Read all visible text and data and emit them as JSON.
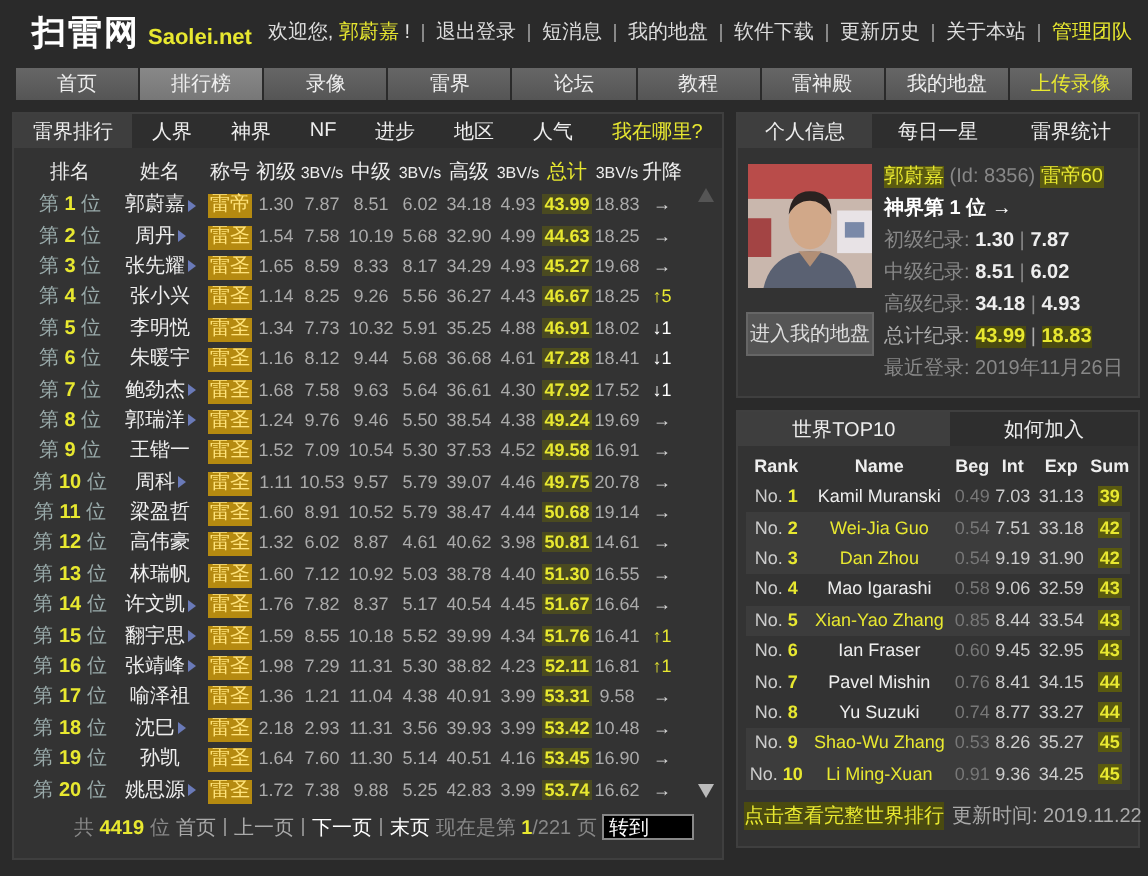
{
  "header": {
    "logo": "扫雷网",
    "logo_sub": "Saolei.net",
    "welcome": "欢迎您,",
    "user": "郭蔚嘉",
    "user_suffix": "!",
    "links": [
      {
        "label": "退出登录",
        "highlighted": false
      },
      {
        "label": "短消息",
        "highlighted": false
      },
      {
        "label": "我的地盘",
        "highlighted": false
      },
      {
        "label": "软件下载",
        "highlighted": false
      },
      {
        "label": "更新历史",
        "highlighted": false
      },
      {
        "label": "关于本站",
        "highlighted": false
      },
      {
        "label": "管理团队",
        "highlighted": true
      }
    ]
  },
  "nav": [
    {
      "label": "首页",
      "selected": false,
      "highlighted": false
    },
    {
      "label": "排行榜",
      "selected": true,
      "highlighted": false
    },
    {
      "label": "录像",
      "selected": false,
      "highlighted": false
    },
    {
      "label": "雷界",
      "selected": false,
      "highlighted": false
    },
    {
      "label": "论坛",
      "selected": false,
      "highlighted": false
    },
    {
      "label": "教程",
      "selected": false,
      "highlighted": false
    },
    {
      "label": "雷神殿",
      "selected": false,
      "highlighted": false
    },
    {
      "label": "我的地盘",
      "selected": false,
      "highlighted": false
    },
    {
      "label": "上传录像",
      "selected": false,
      "highlighted": true
    }
  ],
  "ranking": {
    "tabs": [
      {
        "label": "雷界排行",
        "selected": true,
        "highlighted": false
      },
      {
        "label": "人界",
        "selected": false,
        "highlighted": false
      },
      {
        "label": "神界",
        "selected": false,
        "highlighted": false
      },
      {
        "label": "NF",
        "selected": false,
        "highlighted": false
      },
      {
        "label": "进步",
        "selected": false,
        "highlighted": false
      },
      {
        "label": "地区",
        "selected": false,
        "highlighted": false
      },
      {
        "label": "人气",
        "selected": false,
        "highlighted": false
      },
      {
        "label": "我在哪里?",
        "selected": false,
        "highlighted": true
      }
    ],
    "columns": [
      "排名",
      "姓名",
      "称号",
      "初级",
      "3BV/s",
      "中级",
      "3BV/s",
      "高级",
      "3BV/s",
      "总计",
      "3BV/s",
      "升降"
    ],
    "rows": [
      {
        "rank": "第 **1** 位",
        "name": "郭蔚嘉",
        "video": true,
        "title": "雷帝",
        "values": [
          "1.30",
          "7.87",
          "8.51",
          "6.02",
          "34.18",
          "4.93",
          "43.99",
          "18.83"
        ],
        "change": "→",
        "kind": "same"
      },
      {
        "rank": "第 **2** 位",
        "name": "周丹",
        "video": true,
        "title": "雷圣",
        "values": [
          "1.54",
          "7.58",
          "10.19",
          "5.68",
          "32.90",
          "4.99",
          "44.63",
          "18.25"
        ],
        "change": "→",
        "kind": "same"
      },
      {
        "rank": "第 **3** 位",
        "name": "张先耀",
        "video": true,
        "title": "雷圣",
        "values": [
          "1.65",
          "8.59",
          "8.33",
          "8.17",
          "34.29",
          "4.93",
          "45.27",
          "19.68"
        ],
        "change": "→",
        "kind": "same"
      },
      {
        "rank": "第 **4** 位",
        "name": "张小兴",
        "video": false,
        "title": "雷圣",
        "values": [
          "1.14",
          "8.25",
          "9.26",
          "5.56",
          "36.27",
          "4.43",
          "46.67",
          "18.25"
        ],
        "change": "↑5",
        "kind": "up"
      },
      {
        "rank": "第 **5** 位",
        "name": "李明悦",
        "video": false,
        "title": "雷圣",
        "values": [
          "1.34",
          "7.73",
          "10.32",
          "5.91",
          "35.25",
          "4.88",
          "46.91",
          "18.02"
        ],
        "change": "↓1",
        "kind": "down"
      },
      {
        "rank": "第 **6** 位",
        "name": "朱暖宇",
        "video": false,
        "title": "雷圣",
        "values": [
          "1.16",
          "8.12",
          "9.44",
          "5.68",
          "36.68",
          "4.61",
          "47.28",
          "18.41"
        ],
        "change": "↓1",
        "kind": "down"
      },
      {
        "rank": "第 **7** 位",
        "name": "鲍劲杰",
        "video": true,
        "title": "雷圣",
        "values": [
          "1.68",
          "7.58",
          "9.63",
          "5.64",
          "36.61",
          "4.30",
          "47.92",
          "17.52"
        ],
        "change": "↓1",
        "kind": "down"
      },
      {
        "rank": "第 **8** 位",
        "name": "郭瑞洋",
        "video": true,
        "title": "雷圣",
        "values": [
          "1.24",
          "9.76",
          "9.46",
          "5.50",
          "38.54",
          "4.38",
          "49.24",
          "19.69"
        ],
        "change": "→",
        "kind": "same"
      },
      {
        "rank": "第 **9** 位",
        "name": "王锴一",
        "video": false,
        "title": "雷圣",
        "values": [
          "1.52",
          "7.09",
          "10.54",
          "5.30",
          "37.53",
          "4.52",
          "49.58",
          "16.91"
        ],
        "change": "→",
        "kind": "same"
      },
      {
        "rank": "第 **10** 位",
        "name": "周科",
        "video": true,
        "title": "雷圣",
        "values": [
          "1.11",
          "10.53",
          "9.57",
          "5.79",
          "39.07",
          "4.46",
          "49.75",
          "20.78"
        ],
        "change": "→",
        "kind": "same"
      },
      {
        "rank": "第 **11** 位",
        "name": "梁盈哲",
        "video": false,
        "title": "雷圣",
        "values": [
          "1.60",
          "8.91",
          "10.52",
          "5.79",
          "38.47",
          "4.44",
          "50.68",
          "19.14"
        ],
        "change": "→",
        "kind": "same"
      },
      {
        "rank": "第 **12** 位",
        "name": "高伟豪",
        "video": false,
        "title": "雷圣",
        "values": [
          "1.32",
          "6.02",
          "8.87",
          "4.61",
          "40.62",
          "3.98",
          "50.81",
          "14.61"
        ],
        "change": "→",
        "kind": "same"
      },
      {
        "rank": "第 **13** 位",
        "name": "林瑞帆",
        "video": false,
        "title": "雷圣",
        "values": [
          "1.60",
          "7.12",
          "10.92",
          "5.03",
          "38.78",
          "4.40",
          "51.30",
          "16.55"
        ],
        "change": "→",
        "kind": "same"
      },
      {
        "rank": "第 **14** 位",
        "name": "许文凯",
        "video": true,
        "title": "雷圣",
        "values": [
          "1.76",
          "7.82",
          "8.37",
          "5.17",
          "40.54",
          "4.45",
          "51.67",
          "16.64"
        ],
        "change": "→",
        "kind": "same"
      },
      {
        "rank": "第 **15** 位",
        "name": "翻宇思",
        "video": true,
        "title": "雷圣",
        "values": [
          "1.59",
          "8.55",
          "10.18",
          "5.52",
          "39.99",
          "4.34",
          "51.76",
          "16.41"
        ],
        "change": "↑1",
        "kind": "up"
      },
      {
        "rank": "第 **16** 位",
        "name": "张靖峰",
        "video": true,
        "title": "雷圣",
        "values": [
          "1.98",
          "7.29",
          "11.31",
          "5.30",
          "38.82",
          "4.23",
          "52.11",
          "16.81"
        ],
        "change": "↑1",
        "kind": "up"
      },
      {
        "rank": "第 **17** 位",
        "name": "喻泽祖",
        "video": false,
        "title": "雷圣",
        "values": [
          "1.36",
          "1.21",
          "11.04",
          "4.38",
          "40.91",
          "3.99",
          "53.31",
          "9.58"
        ],
        "change": "→",
        "kind": "same"
      },
      {
        "rank": "第 **18** 位",
        "name": "沈巳",
        "video": true,
        "title": "雷圣",
        "values": [
          "2.18",
          "2.93",
          "11.31",
          "3.56",
          "39.93",
          "3.99",
          "53.42",
          "10.48"
        ],
        "change": "→",
        "kind": "same"
      },
      {
        "rank": "第 **19** 位",
        "name": "孙凯",
        "video": false,
        "title": "雷圣",
        "values": [
          "1.64",
          "7.60",
          "11.30",
          "5.14",
          "40.51",
          "4.16",
          "53.45",
          "16.90"
        ],
        "change": "→",
        "kind": "same"
      },
      {
        "rank": "第 **20** 位",
        "name": "姚思源",
        "video": true,
        "title": "雷圣",
        "values": [
          "1.72",
          "7.38",
          "9.88",
          "5.25",
          "42.83",
          "3.99",
          "53.74",
          "16.62"
        ],
        "change": "→",
        "kind": "same"
      }
    ],
    "pager": {
      "total": "共 **4419** 位",
      "first": "首页",
      "prev": "上一页",
      "next": "下一页",
      "last": "末页",
      "current": "现在是第 **1**/221 页",
      "goto": "转到"
    }
  },
  "profile": {
    "tabs": [
      {
        "label": "个人信息",
        "selected": true
      },
      {
        "label": "每日一星",
        "selected": false
      },
      {
        "label": "雷界统计",
        "selected": false
      }
    ],
    "name": "郭蔚嘉",
    "id": "(Id: 8356)",
    "level": "雷帝60",
    "position": "神界第 1 位 →",
    "records": [
      {
        "text": "初级纪录: **1.30** | **7.87**",
        "highlighted": false
      },
      {
        "text": "中级纪录: **8.51** | **6.02**",
        "highlighted": false
      },
      {
        "text": "高级纪录: **34.18** | **4.93**",
        "highlighted": false
      },
      {
        "text": "总计纪录: **43.99** | **18.83**",
        "highlighted": true
      }
    ],
    "last_login": "最近登录: 2019年11月26日",
    "button": "进入我的地盘"
  },
  "top10": {
    "tabs": [
      {
        "label": "世界TOP10",
        "selected": true
      },
      {
        "label": "如何加入",
        "selected": false
      }
    ],
    "columns": [
      "Rank",
      "Name",
      "Beg",
      "Int",
      "Exp",
      "Sum"
    ],
    "rows": [
      {
        "rank": "No. **1**",
        "name": "Kamil Muranski",
        "values": [
          "0.49",
          "7.03",
          "31.13"
        ],
        "sum": "39",
        "highlighted": false
      },
      {
        "rank": "No. **2**",
        "name": "Wei-Jia Guo",
        "values": [
          "0.54",
          "7.51",
          "33.18"
        ],
        "sum": "42",
        "highlighted": true
      },
      {
        "rank": "No. **3**",
        "name": "Dan Zhou",
        "values": [
          "0.54",
          "9.19",
          "31.90"
        ],
        "sum": "42",
        "highlighted": true
      },
      {
        "rank": "No. **4**",
        "name": "Mao Igarashi",
        "values": [
          "0.58",
          "9.06",
          "32.59"
        ],
        "sum": "43",
        "highlighted": false
      },
      {
        "rank": "No. **5**",
        "name": "Xian-Yao Zhang",
        "values": [
          "0.85",
          "8.44",
          "33.54"
        ],
        "sum": "43",
        "highlighted": true
      },
      {
        "rank": "No. **6**",
        "name": "Ian Fraser",
        "values": [
          "0.60",
          "9.45",
          "32.95"
        ],
        "sum": "43",
        "highlighted": false
      },
      {
        "rank": "No. **7**",
        "name": "Pavel Mishin",
        "values": [
          "0.76",
          "8.41",
          "34.15"
        ],
        "sum": "44",
        "highlighted": false
      },
      {
        "rank": "No. **8**",
        "name": "Yu Suzuki",
        "values": [
          "0.74",
          "8.77",
          "33.27"
        ],
        "sum": "44",
        "highlighted": false
      },
      {
        "rank": "No. **9**",
        "name": "Shao-Wu Zhang",
        "values": [
          "0.53",
          "8.26",
          "35.27"
        ],
        "sum": "45",
        "highlighted": true
      },
      {
        "rank": "No. **10**",
        "name": "Li Ming-Xuan",
        "values": [
          "0.91",
          "9.36",
          "34.25"
        ],
        "sum": "45",
        "highlighted": true
      }
    ],
    "link": "点击查看完整世界排行",
    "updated": "更新时间: 2019.11.22"
  }
}
